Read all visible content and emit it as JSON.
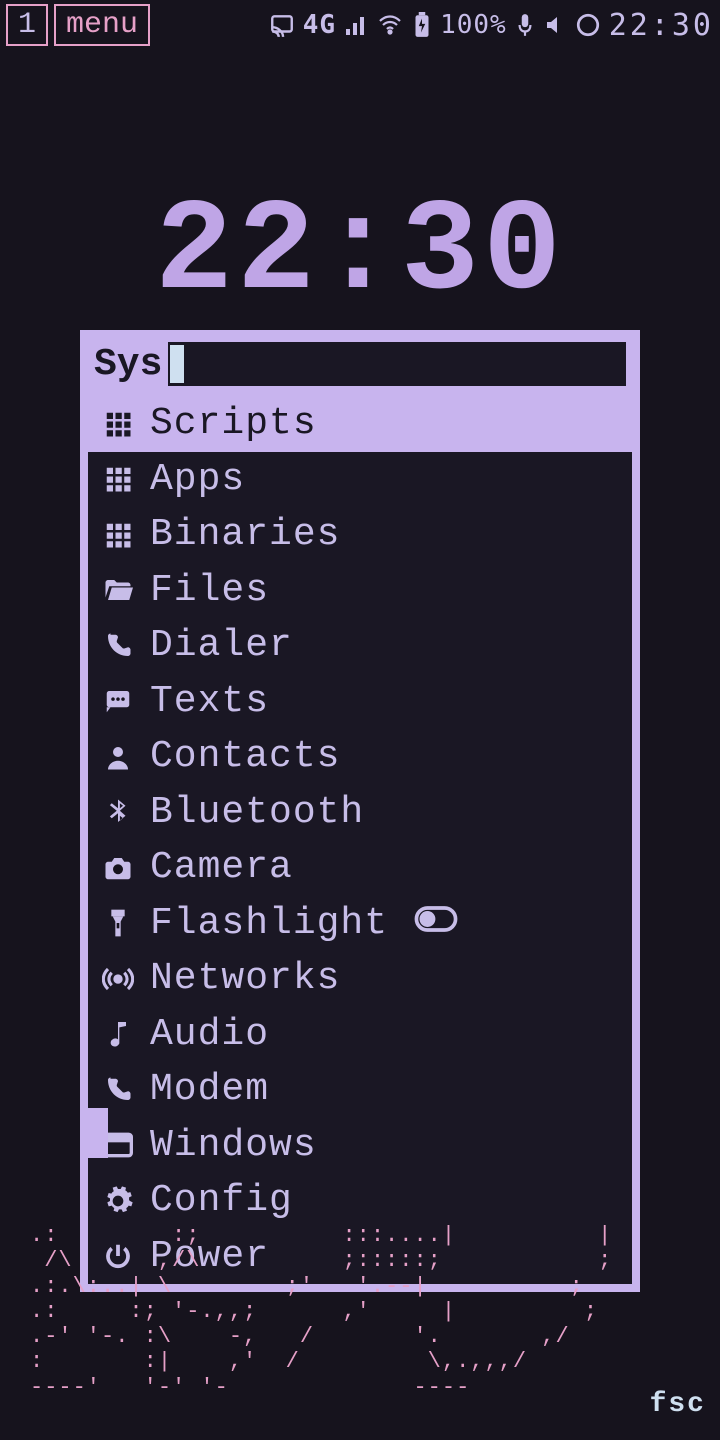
{
  "statusbar": {
    "workspace": "1",
    "menu_label": "menu",
    "network": "4G",
    "battery_pct": "100%",
    "time": "22:30"
  },
  "clock": "22:30",
  "launcher": {
    "label": "Sys",
    "input_value": "",
    "items": [
      {
        "icon": "grid-icon",
        "label": "Scripts",
        "selected": true
      },
      {
        "icon": "grid-icon",
        "label": "Apps"
      },
      {
        "icon": "grid-icon",
        "label": "Binaries"
      },
      {
        "icon": "folder-open-icon",
        "label": "Files"
      },
      {
        "icon": "phone-icon",
        "label": "Dialer"
      },
      {
        "icon": "message-icon",
        "label": "Texts"
      },
      {
        "icon": "person-icon",
        "label": "Contacts"
      },
      {
        "icon": "bluetooth-icon",
        "label": "Bluetooth"
      },
      {
        "icon": "camera-icon",
        "label": "Camera"
      },
      {
        "icon": "flashlight-icon",
        "label": "Flashlight",
        "trail_icon": "toggle-off-icon"
      },
      {
        "icon": "broadcast-icon",
        "label": "Networks"
      },
      {
        "icon": "music-note-icon",
        "label": "Audio"
      },
      {
        "icon": "phone-icon",
        "label": "Modem"
      },
      {
        "icon": "window-icon",
        "label": "Windows"
      },
      {
        "icon": "gear-icon",
        "label": "Config"
      },
      {
        "icon": "power-icon",
        "label": "Power"
      }
    ]
  },
  "footer": {
    "tag": "fsc"
  },
  "ascii": ".:        :;          :::....|          |\n /\\      ,/\\          ;:::::;           ;\n.:.\\:..| \\        ;'   '.--|          ;\n.:     :; '-.,,;      ,'     |         ;\n.-' '-. :\\    -,   /       '.       ,/\n:       :|    ,'  /         \\,.,,,/ \n----'   '-' '-             ----     ",
  "colors": {
    "bg": "#16131d",
    "fg": "#c7bde8",
    "accent": "#c8b4ee",
    "pink": "#e6a0c8"
  }
}
